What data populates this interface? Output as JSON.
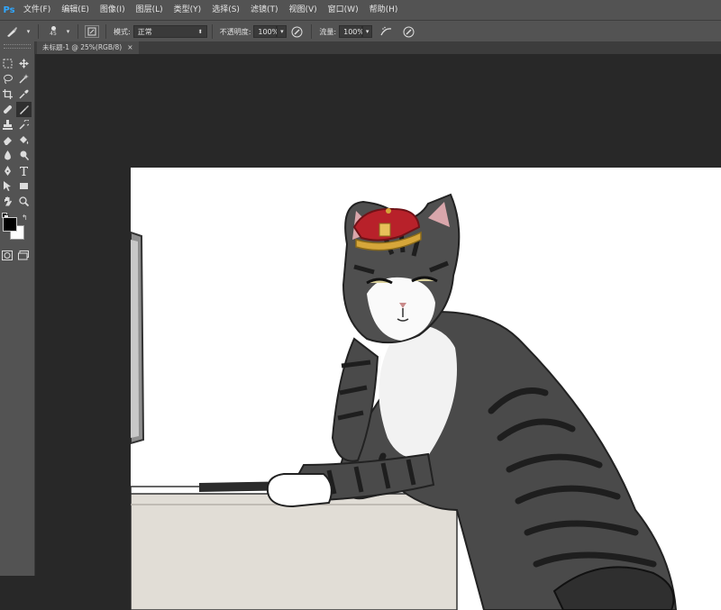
{
  "app": {
    "logo_text": "Ps",
    "menu": [
      "文件(F)",
      "编辑(E)",
      "图像(I)",
      "图层(L)",
      "类型(Y)",
      "选择(S)",
      "滤镜(T)",
      "视图(V)",
      "窗口(W)",
      "帮助(H)"
    ]
  },
  "options": {
    "brush_size": "45",
    "mode_label": "模式:",
    "mode_value": "正常",
    "opacity_label": "不透明度:",
    "opacity_value": "100%",
    "flow_label": "流量:",
    "flow_value": "100%"
  },
  "document": {
    "tab_title": "未标题-1 @ 25%(RGB/8)",
    "tab_close": "×"
  },
  "colors": {
    "foreground": "#000000",
    "background": "#ffffff",
    "panel": "#535353",
    "workspace": "#282828"
  },
  "tools": [
    "move-icon",
    "marquee-icon",
    "lasso-icon",
    "magic-wand-icon",
    "crop-icon",
    "eyedropper-icon",
    "healing-icon",
    "brush-icon",
    "stamp-icon",
    "history-brush-icon",
    "eraser-icon",
    "bucket-icon",
    "blur-icon",
    "dodge-icon",
    "pen-icon",
    "type-icon",
    "path-select-icon",
    "shape-icon",
    "hand-icon",
    "zoom-icon"
  ]
}
